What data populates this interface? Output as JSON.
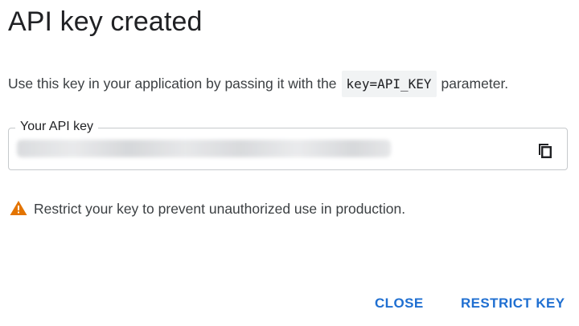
{
  "dialog": {
    "title": "API key created",
    "description": {
      "prefix": "Use this key in your application by passing it with the",
      "code": "key=API_KEY",
      "suffix": "parameter."
    },
    "key_field": {
      "label": "Your API key",
      "value": "",
      "copy_icon": "copy-icon"
    },
    "warning": {
      "icon": "warning-icon",
      "text": "Restrict your key to prevent unauthorized use in production."
    },
    "actions": {
      "close_label": "CLOSE",
      "restrict_label": "RESTRICT KEY"
    },
    "colors": {
      "accent": "#1f6fd1",
      "warning": "#e37400"
    }
  }
}
